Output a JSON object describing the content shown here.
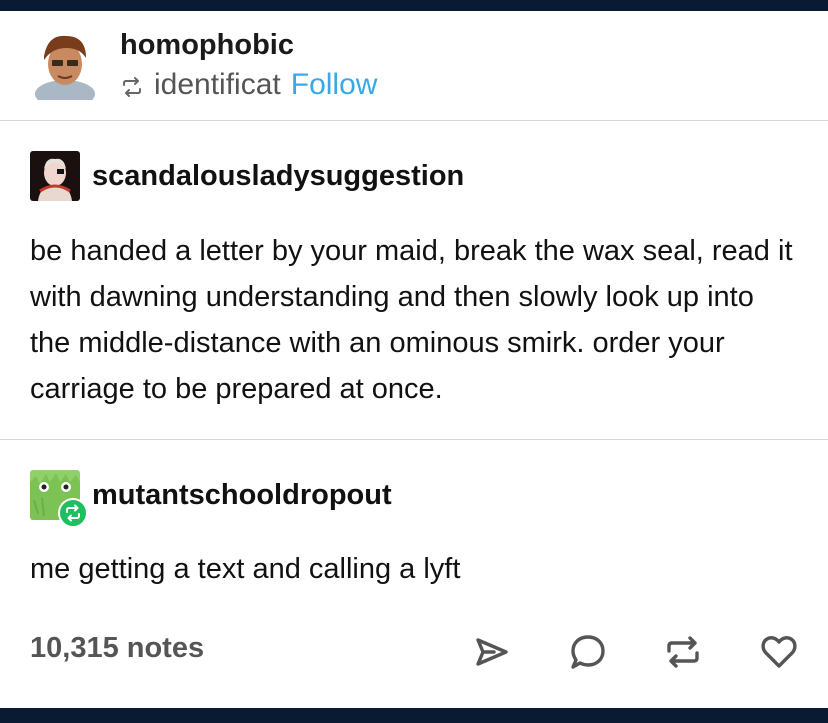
{
  "header": {
    "username": "homophobic",
    "reblogged_from": "identificat",
    "follow_label": "Follow"
  },
  "posts": [
    {
      "username": "scandalousladysuggestion",
      "text": "be handed a letter by your maid, break the wax seal, read it with dawning understanding and then slowly look up into the middle-distance with an ominous smirk. order your carriage to be prepared at once."
    },
    {
      "username": "mutantschooldropout",
      "text": "me getting a text and calling a lyft"
    }
  ],
  "footer": {
    "notes": "10,315 notes",
    "actions": [
      "share-icon",
      "reply-icon",
      "reblog-icon",
      "like-icon"
    ]
  },
  "colors": {
    "top_bar": "#0b1a33",
    "follow": "#39a9e6",
    "reblog_badge": "#1dbf60",
    "divider": "#d6d6d6"
  }
}
